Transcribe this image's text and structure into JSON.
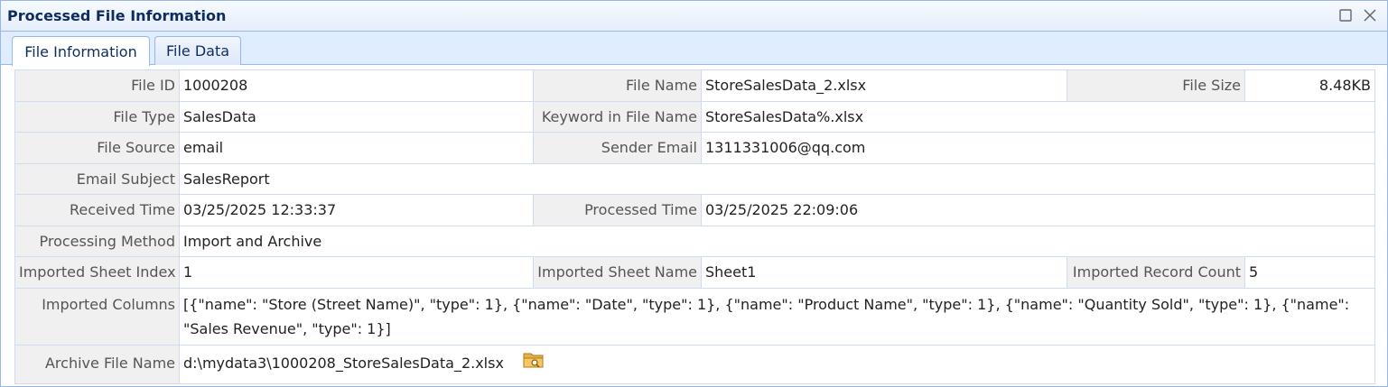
{
  "window": {
    "title": "Processed File Information"
  },
  "tabs": [
    {
      "label": "File Information",
      "active": true
    },
    {
      "label": "File Data",
      "active": false
    }
  ],
  "info": {
    "file_id_label": "File ID",
    "file_id": "1000208",
    "file_name_label": "File Name",
    "file_name": "StoreSalesData_2.xlsx",
    "file_size_label": "File Size",
    "file_size": "8.48KB",
    "file_type_label": "File Type",
    "file_type": "SalesData",
    "keyword_label": "Keyword in File Name",
    "keyword": "StoreSalesData%.xlsx",
    "file_source_label": "File Source",
    "file_source": "email",
    "sender_email_label": "Sender Email",
    "sender_email": "1311331006@qq.com",
    "email_subject_label": "Email Subject",
    "email_subject": "SalesReport",
    "received_time_label": "Received Time",
    "received_time": "03/25/2025 12:33:37",
    "processed_time_label": "Processed Time",
    "processed_time": "03/25/2025 22:09:06",
    "processing_method_label": "Processing Method",
    "processing_method": "Import and Archive",
    "sheet_index_label": "Imported Sheet Index",
    "sheet_index": "1",
    "sheet_name_label": "Imported Sheet Name",
    "sheet_name": "Sheet1",
    "record_count_label": "Imported Record Count",
    "record_count": "5",
    "columns_label": "Imported Columns",
    "columns": "[{\"name\": \"Store (Street Name)\", \"type\": 1}, {\"name\": \"Date\", \"type\": 1}, {\"name\": \"Product Name\", \"type\": 1}, {\"name\": \"Quantity Sold\", \"type\": 1}, {\"name\": \"Sales Revenue\", \"type\": 1}]",
    "archive_label": "Archive File Name",
    "archive_file": "d:\\mydata3\\1000208_StoreSalesData_2.xlsx"
  },
  "icons": {
    "maximize": "maximize-icon",
    "close": "close-icon",
    "folder": "folder-open-icon"
  },
  "colors": {
    "border": "#95b8e7",
    "header_bg": "#e0ecff",
    "title_text": "#0e2d5f",
    "label_bg": "#f0f0f0"
  }
}
